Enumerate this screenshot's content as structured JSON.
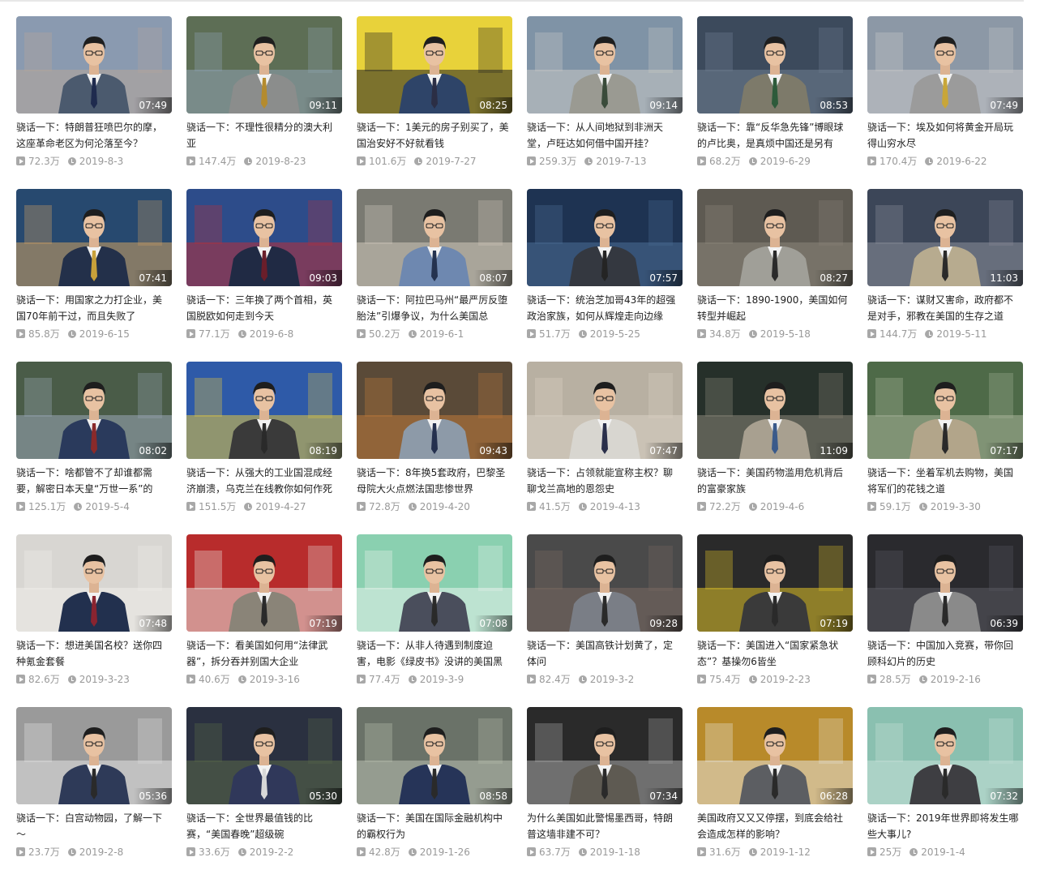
{
  "videos": [
    {
      "title": "骁话一下：特朗普狂喷巴尔的摩，这座革命老区为何沦落至今？",
      "duration": "07:49",
      "views": "72.3万",
      "date": "2019-8-3",
      "scene": {
        "bg": "#8a9ab0",
        "bg2": "#b7a79a",
        "suit": "#4b5a6e",
        "tie": "#1f2b4e"
      }
    },
    {
      "title": "骁话一下：不理性很精分的澳大利亚",
      "duration": "09:11",
      "views": "147.4万",
      "date": "2019-8-23",
      "scene": {
        "bg": "#5d6e55",
        "bg2": "#8fa4b4",
        "suit": "#8b8d8c",
        "tie": "#b48b2e"
      }
    },
    {
      "title": "骁话一下：1美元的房子别买了，美国治安好不好就看钱",
      "duration": "08:25",
      "views": "101.6万",
      "date": "2019-7-27",
      "scene": {
        "bg": "#e8d23a",
        "bg2": "#222222",
        "suit": "#2e4468",
        "tie": "#2b2e45"
      }
    },
    {
      "title": "骁话一下：从人间地狱到非洲天堂，卢旺达如何借中国开挂？",
      "duration": "09:14",
      "views": "259.3万",
      "date": "2019-7-13",
      "scene": {
        "bg": "#7f93a6",
        "bg2": "#c9c9c5",
        "suit": "#9a9a92",
        "tie": "#3a4b3a"
      }
    },
    {
      "title": "骁话一下：靠“反华急先锋”博眼球的卢比奥，是真烦中国还是另有",
      "duration": "08:53",
      "views": "68.2万",
      "date": "2019-6-29",
      "scene": {
        "bg": "#3c4a5c",
        "bg2": "#6f7f92",
        "suit": "#7d7a6a",
        "tie": "#2d5a3a"
      }
    },
    {
      "title": "骁话一下：埃及如何将黄金开局玩得山穷水尽",
      "duration": "07:49",
      "views": "170.4万",
      "date": "2019-6-22",
      "scene": {
        "bg": "#8c98a6",
        "bg2": "#c8c8c8",
        "suit": "#9b9b9b",
        "tie": "#c8a639"
      }
    },
    {
      "title": "骁话一下：用国家之力打企业，美国70年前干过，而且失败了",
      "duration": "07:41",
      "views": "85.8万",
      "date": "2019-6-15",
      "scene": {
        "bg": "#27496f",
        "bg2": "#d0a060",
        "suit": "#23304a",
        "tie": "#c8a13a"
      }
    },
    {
      "title": "骁话一下：三年换了两个首相，英国脱欧如何走到今天",
      "duration": "09:03",
      "views": "77.1万",
      "date": "2019-6-8",
      "scene": {
        "bg": "#2d4c8a",
        "bg2": "#b8303a",
        "suit": "#202a44",
        "tie": "#6a1e2a"
      }
    },
    {
      "title": "骁话一下：阿拉巴马州“最严厉反堕胎法”引爆争议，为什么美国总",
      "duration": "08:07",
      "views": "50.2万",
      "date": "2019-6-1",
      "scene": {
        "bg": "#7a7a72",
        "bg2": "#cfc8bc",
        "suit": "#6e88b0",
        "tie": "#24324f"
      }
    },
    {
      "title": "骁话一下：统治芝加哥43年的超强政治家族，如何从辉煌走向边缘",
      "duration": "07:57",
      "views": "51.7万",
      "date": "2019-5-25",
      "scene": {
        "bg": "#1e3352",
        "bg2": "#4c6e95",
        "suit": "#343840",
        "tie": "#242424"
      }
    },
    {
      "title": "骁话一下：1890-1900，美国如何转型并崛起",
      "duration": "08:27",
      "views": "34.8万",
      "date": "2019-5-18",
      "scene": {
        "bg": "#5e5a52",
        "bg2": "#8c867a",
        "suit": "#a09f98",
        "tie": "#2a2a2a"
      }
    },
    {
      "title": "骁话一下：谋财又害命，政府都不是对手，邪教在美国的生存之道",
      "duration": "11:03",
      "views": "144.7万",
      "date": "2019-5-11",
      "scene": {
        "bg": "#3c4658",
        "bg2": "#8a8f9a",
        "suit": "#b7ab8f",
        "tie": "#2a2a2a"
      }
    },
    {
      "title": "骁话一下：啥都管不了却谁都需要，解密日本天皇“万世一系”的",
      "duration": "08:02",
      "views": "125.1万",
      "date": "2019-5-4",
      "scene": {
        "bg": "#4a5c48",
        "bg2": "#9aa8b8",
        "suit": "#2a3a5c",
        "tie": "#8a2a2a"
      }
    },
    {
      "title": "骁话一下：从强大的工业国混成经济崩溃，乌克兰在线教你如何作死",
      "duration": "08:19",
      "views": "151.5万",
      "date": "2019-4-27",
      "scene": {
        "bg": "#2e5aa8",
        "bg2": "#e2c640",
        "suit": "#3a3a3a",
        "tie": "#2a2a2a"
      }
    },
    {
      "title": "骁话一下：8年换5套政府，巴黎圣母院大火点燃法国悲惨世界",
      "duration": "09:43",
      "views": "72.8万",
      "date": "2019-4-20",
      "scene": {
        "bg": "#5a4a38",
        "bg2": "#c07a3a",
        "suit": "#8d9aa8",
        "tie": "#24304e"
      }
    },
    {
      "title": "骁话一下：占领就能宣称主权？聊聊戈兰高地的恩怨史",
      "duration": "07:47",
      "views": "41.5万",
      "date": "2019-4-13",
      "scene": {
        "bg": "#b8b0a2",
        "bg2": "#d9d2c4",
        "suit": "#d8d6d0",
        "tie": "#2a2f4a"
      }
    },
    {
      "title": "骁话一下：美国药物滥用危机背后的富豪家族",
      "duration": "11:09",
      "views": "72.2万",
      "date": "2019-4-6",
      "scene": {
        "bg": "#26302a",
        "bg2": "#8a8678",
        "suit": "#a8a090",
        "tie": "#3a5a8a"
      }
    },
    {
      "title": "骁话一下：坐着军机去购物，美国将军们的花钱之道",
      "duration": "07:17",
      "views": "59.1万",
      "date": "2019-3-30",
      "scene": {
        "bg": "#4e6a48",
        "bg2": "#a9b59a",
        "suit": "#b2a58a",
        "tie": "#2a2a2a"
      }
    },
    {
      "title": "骁话一下：想进美国名校？送你四种氪金套餐",
      "duration": "07:48",
      "views": "82.6万",
      "date": "2019-3-23",
      "scene": {
        "bg": "#d8d6d2",
        "bg2": "#f0eeea",
        "suit": "#22304e",
        "tie": "#8a2430"
      }
    },
    {
      "title": "骁话一下：看美国如何用“法律武器”，拆分吞并别国大企业",
      "duration": "07:19",
      "views": "40.6万",
      "date": "2019-3-16",
      "scene": {
        "bg": "#b82c2c",
        "bg2": "#e8e6e0",
        "suit": "#8a8478",
        "tie": "#2a2a2a"
      }
    },
    {
      "title": "骁话一下：从非人待遇到制度迫害，电影《绿皮书》没讲的美国黑",
      "duration": "07:08",
      "views": "77.4万",
      "date": "2019-3-9",
      "scene": {
        "bg": "#8ad0b0",
        "bg2": "#e8f2ec",
        "suit": "#4a4e5c",
        "tie": "#2a2a2a"
      }
    },
    {
      "title": "骁话一下：美国高铁计划黄了，定体问",
      "duration": "09:28",
      "views": "82.4万",
      "date": "2019-3-2",
      "scene": {
        "bg": "#4a4a4a",
        "bg2": "#7a6a62",
        "suit": "#7a7e86",
        "tie": "#2a2a2a"
      }
    },
    {
      "title": "骁话一下：美国进入“国家紧急状态”？基操勿6皆坐",
      "duration": "07:19",
      "views": "75.4万",
      "date": "2019-2-23",
      "scene": {
        "bg": "#2a2a2a",
        "bg2": "#e0c228",
        "suit": "#3a3a3a",
        "tie": "#2a2a2a"
      }
    },
    {
      "title": "骁话一下：中国加入竞赛，带你回顾科幻片的历史",
      "duration": "06:39",
      "views": "28.5万",
      "date": "2019-2-16",
      "scene": {
        "bg": "#2a2a2e",
        "bg2": "#5a5a62",
        "suit": "#8a8a8a",
        "tie": "#2a2a2a"
      }
    },
    {
      "title": "骁话一下：白宫动物园，了解一下～",
      "duration": "05:36",
      "views": "23.7万",
      "date": "2019-2-8",
      "scene": {
        "bg": "#9a9a9a",
        "bg2": "#e2e2e2",
        "suit": "#2e3a58",
        "tie": "#2a2a2a"
      }
    },
    {
      "title": "骁话一下：全世界最值钱的比赛，“美国春晚”超级碗",
      "duration": "05:30",
      "views": "33.6万",
      "date": "2019-2-2",
      "scene": {
        "bg": "#2a3040",
        "bg2": "#5a6a48",
        "suit": "#30385a",
        "tie": "#d8d8d8"
      }
    },
    {
      "title": "骁话一下：美国在国际金融机构中的霸权行为",
      "duration": "08:58",
      "views": "42.8万",
      "date": "2019-1-26",
      "scene": {
        "bg": "#6a7268",
        "bg2": "#b8c0b0",
        "suit": "#263458",
        "tie": "#2a2a2a"
      }
    },
    {
      "title": "为什么美国如此警惕墨西哥，特朗普这墙非建不可？",
      "duration": "07:34",
      "views": "63.7万",
      "date": "2019-1-18",
      "scene": {
        "bg": "#2a2a2a",
        "bg2": "#a8a8a8",
        "suit": "#5e5a52",
        "tie": "#2a2a2a"
      }
    },
    {
      "title": "美国政府又又又停摆，到底会给社会造成怎样的影响？",
      "duration": "06:28",
      "views": "31.6万",
      "date": "2019-1-12",
      "scene": {
        "bg": "#b88a2a",
        "bg2": "#e6e2d8",
        "suit": "#5c5e62",
        "tie": "#2a2a2a"
      }
    },
    {
      "title": "骁话一下：2019年世界即将发生哪些大事儿?",
      "duration": "07:32",
      "views": "25万",
      "date": "2019-1-4",
      "scene": {
        "bg": "#8ac0b0",
        "bg2": "#c6e0d8",
        "suit": "#3e3e42",
        "tie": "#2a2a2a"
      }
    }
  ]
}
